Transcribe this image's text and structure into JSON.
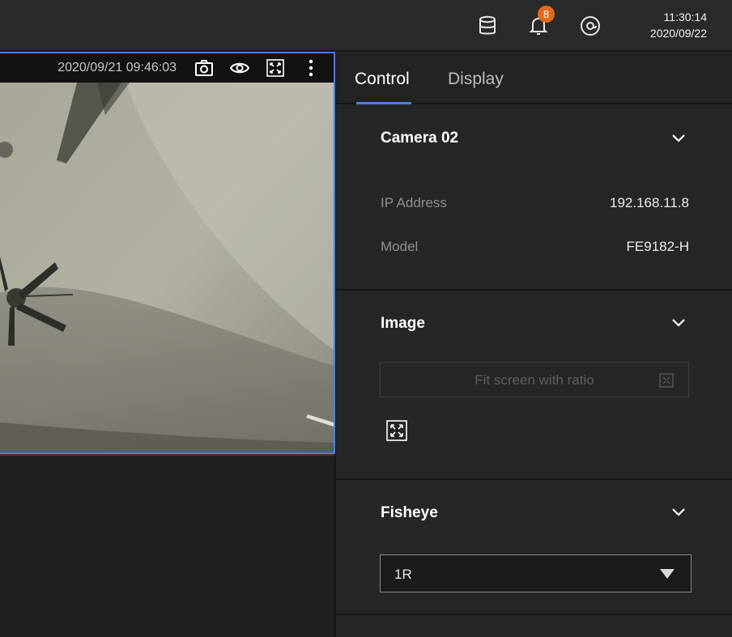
{
  "header": {
    "notification_count": "8",
    "clock_time": "11:30:14",
    "clock_date": "2020/09/22",
    "icons": [
      "database-icon",
      "bell-icon",
      "user-icon"
    ],
    "badge_color": "#e36a1c"
  },
  "viewport": {
    "timestamp": "2020/09/21 09:46:03",
    "icons": [
      "camera-icon",
      "eye-icon",
      "fit-screen-icon",
      "more-vertical-icon"
    ],
    "selected_border_color": "#4f7dd9"
  },
  "panel": {
    "tabs": [
      {
        "label": "Control",
        "active": true
      },
      {
        "label": "Display",
        "active": false
      }
    ],
    "camera": {
      "title": "Camera 02",
      "ip_label": "IP Address",
      "ip_value": "192.168.11.8",
      "model_label": "Model",
      "model_value": "FE9182-H"
    },
    "image": {
      "title": "Image",
      "fit_placeholder": "Fit screen with ratio"
    },
    "fisheye": {
      "title": "Fisheye",
      "selected": "1R"
    }
  }
}
